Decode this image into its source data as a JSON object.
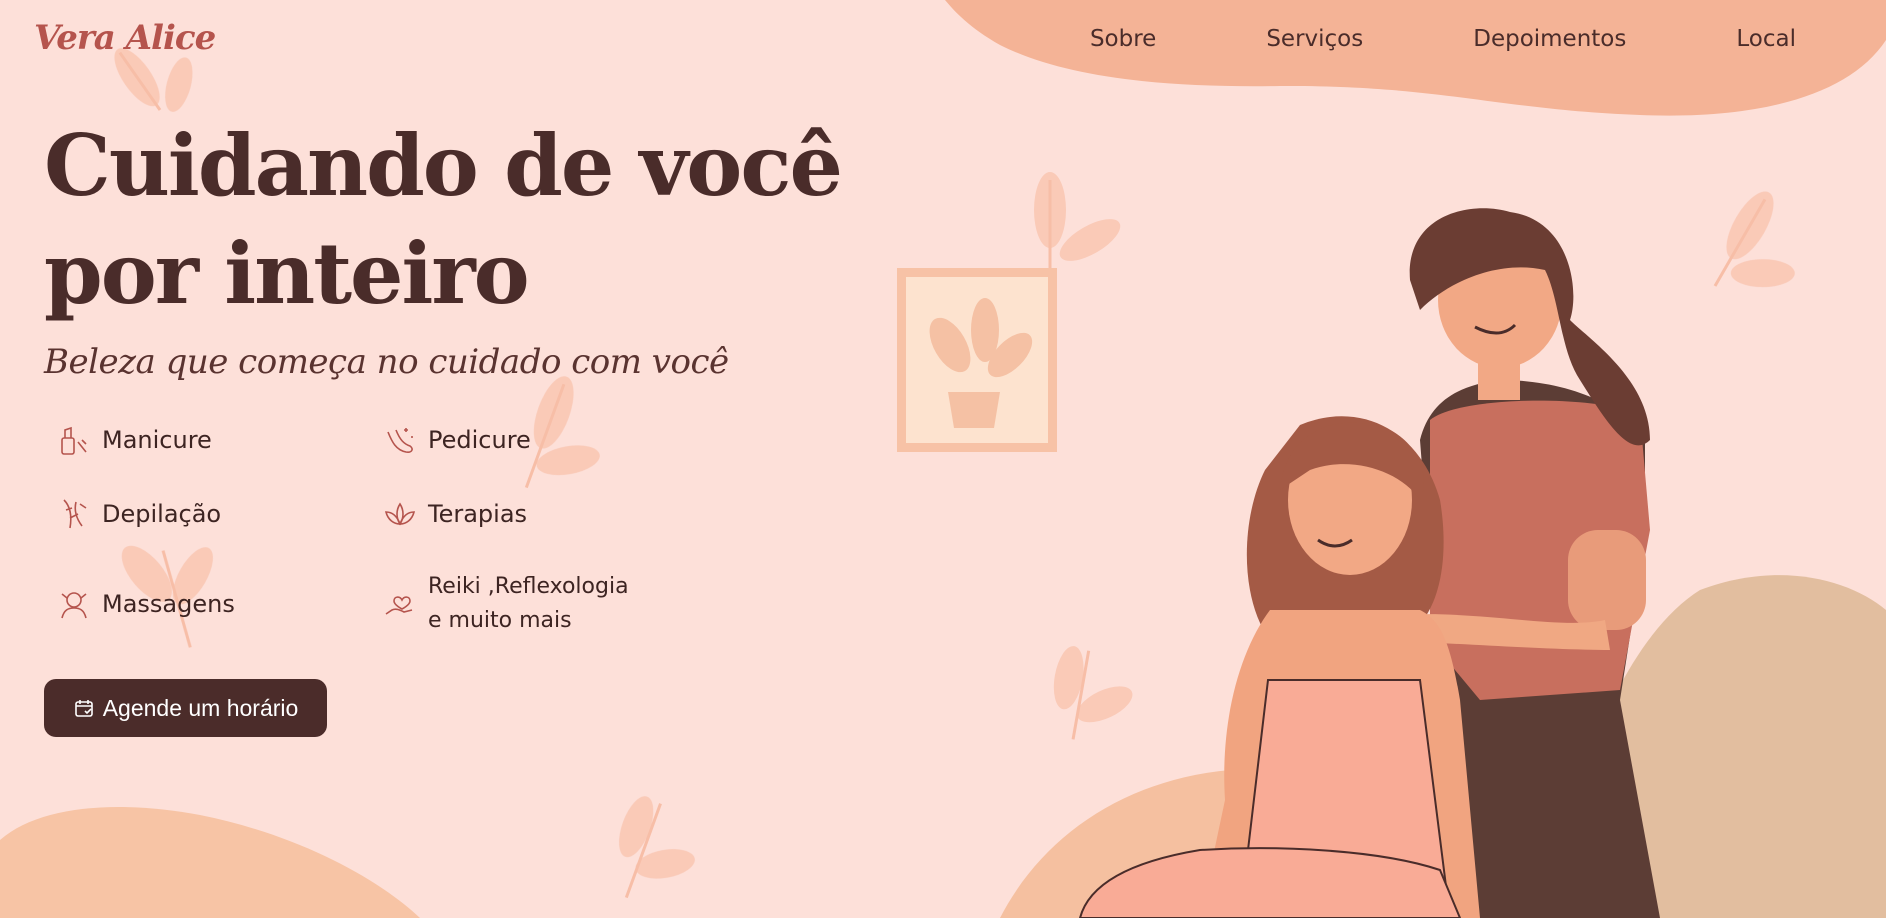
{
  "brand": {
    "logo": "Vera Alice"
  },
  "nav": {
    "items": [
      "Sobre",
      "Serviços",
      "Depoimentos",
      "Local"
    ]
  },
  "hero": {
    "title_line1": "Cuidando de você",
    "title_line2": "por inteiro",
    "subtitle": "Beleza que começa no cuidado com você"
  },
  "services": [
    {
      "label": "Manicure",
      "icon": "nail-polish-icon"
    },
    {
      "label": "Pedicure",
      "icon": "foot-icon"
    },
    {
      "label": "Depilação",
      "icon": "leg-wax-icon"
    },
    {
      "label": "Terapias",
      "icon": "lotus-icon"
    },
    {
      "label": "Massagens",
      "icon": "massage-face-icon"
    },
    {
      "label_line1": "Reiki ,Reflexologia",
      "label_line2": "e muito mais",
      "icon": "hand-heart-icon"
    }
  ],
  "cta": {
    "label": "Agende um horário",
    "icon": "calendar-icon"
  },
  "colors": {
    "background": "#fde0d9",
    "blob": "#f4b396",
    "accent": "#b5544d",
    "dark": "#4b2c2a",
    "leaf": "#f9c7b3"
  }
}
